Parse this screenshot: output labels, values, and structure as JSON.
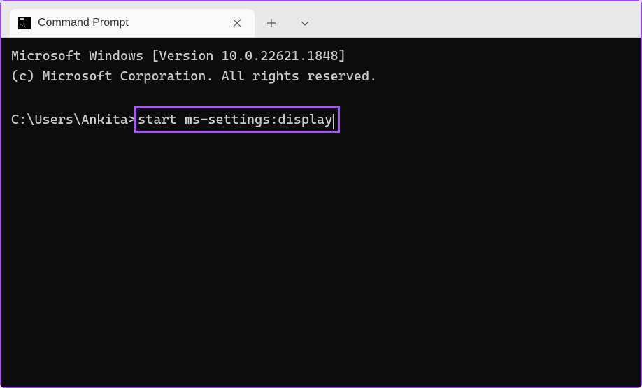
{
  "tab": {
    "title": "Command Prompt"
  },
  "terminal": {
    "line1": "Microsoft Windows [Version 10.0.22621.1848]",
    "line2": "(c) Microsoft Corporation. All rights reserved.",
    "prompt": "C:\\Users\\Ankita>",
    "command": "start ms-settings:display"
  }
}
